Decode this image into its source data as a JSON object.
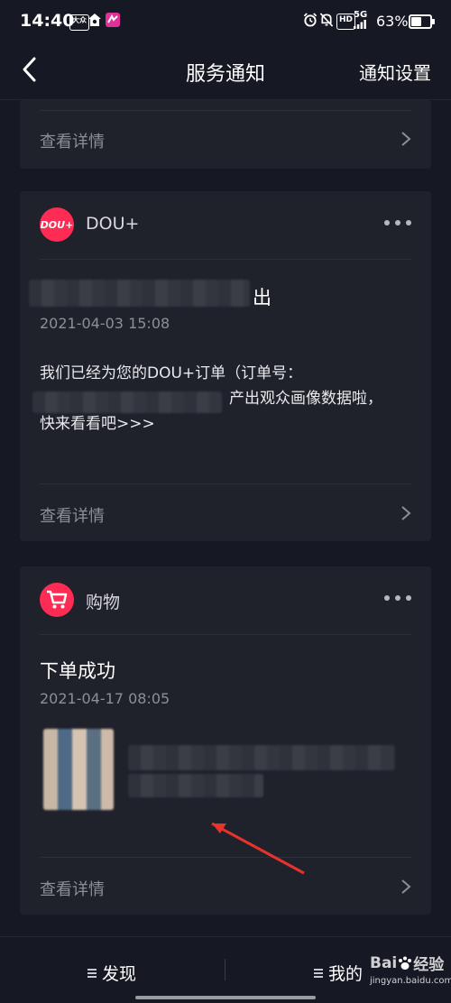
{
  "status_bar": {
    "time": "14:40",
    "left_icons": [
      "hd-badge-icon",
      "home-shield-icon",
      "app-notification-icon"
    ],
    "right_icons": [
      "alarm-icon",
      "mute-bell-icon",
      "hd-icon",
      "5g-signal-icon"
    ],
    "hd_label": "HD",
    "signal_label": "5G",
    "battery_percent": 63,
    "battery_text": "63%"
  },
  "nav": {
    "title": "服务通知",
    "settings_label": "通知设置"
  },
  "cards": [
    {
      "detail_label": "查看详情"
    },
    {
      "source": "DOU+",
      "logo_text": "DOU+",
      "title_tail": "出",
      "time": "2021-04-03 15:08",
      "body_line1": "我们已经为您的DOU+订单（订单号：",
      "body_line2_tail": "产出观众画像数据啦，",
      "body_line3": "快来看看吧>>>",
      "detail_label": "查看详情"
    },
    {
      "source": "购物",
      "title": "下单成功",
      "time": "2021-04-17 08:05",
      "detail_label": "查看详情"
    }
  ],
  "tabbar": {
    "tabs": [
      {
        "label": "发现"
      },
      {
        "label": "我的"
      }
    ]
  },
  "watermark": {
    "brand": "Bai",
    "suffix": "经验",
    "url": "jingyan.baidu.com"
  },
  "colors": {
    "background": "#161823",
    "card": "#1f212b",
    "accent": "#fe2c55",
    "annotation_arrow": "#e8322e"
  }
}
